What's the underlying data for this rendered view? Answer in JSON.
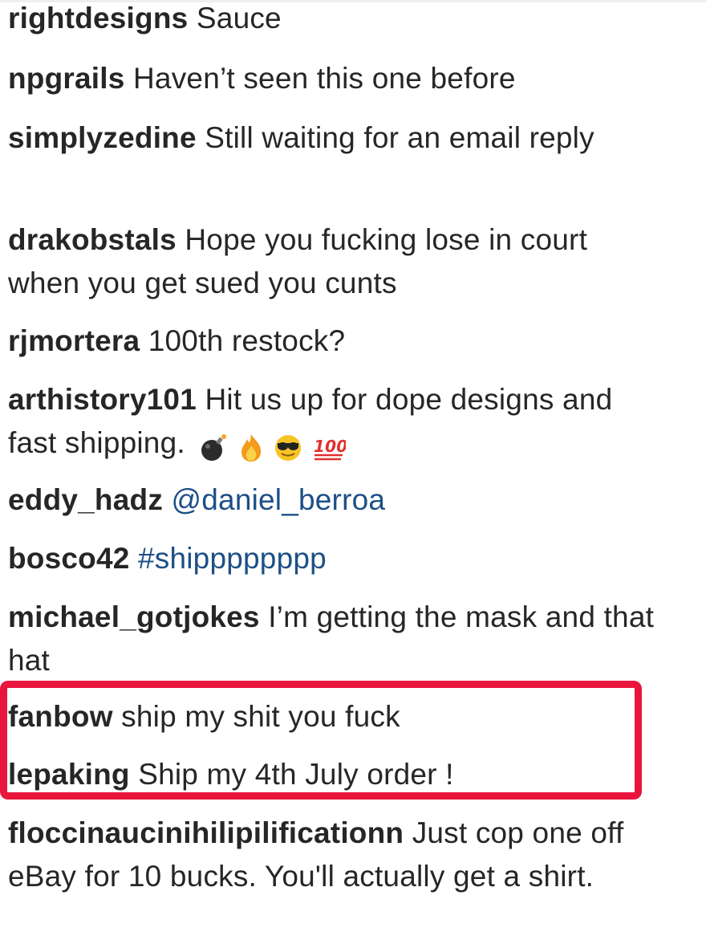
{
  "comments": [
    {
      "user": "rightdesigns",
      "text": "Sauce"
    },
    {
      "user": "npgrails",
      "text": "Haven’t seen this one before"
    },
    {
      "user": "simplyzedine",
      "text": "Still waiting for an email reply"
    },
    {
      "user": "drakobstals",
      "text": "Hope you fucking lose in court when you get sued you cunts"
    },
    {
      "user": "rjmortera",
      "text": "100th restock?"
    },
    {
      "user": "arthistory101",
      "text": "Hit us up for dope designs and fast shipping.",
      "emojis": [
        "bomb-icon",
        "fire-icon",
        "sunglasses-face-icon",
        "hundred-points-icon"
      ]
    },
    {
      "user": "eddy_hadz",
      "text": "@daniel_berroa"
    },
    {
      "user": "bosco42",
      "text": "#shipppppppp"
    },
    {
      "user": "michael_gotjokes",
      "text": "I’m getting the mask and that hat"
    },
    {
      "user": "fanbow",
      "text": "ship my shit you fuck"
    },
    {
      "user": "lepaking",
      "text": "Ship my 4th July order !"
    },
    {
      "user": "floccinaucinihilipilificationn",
      "text": "Just cop one off eBay for 10 bucks. You'll actually get a shirt."
    }
  ],
  "colors": {
    "text": "#262626",
    "link": "#1d4f87",
    "highlight": "#e8163c"
  }
}
